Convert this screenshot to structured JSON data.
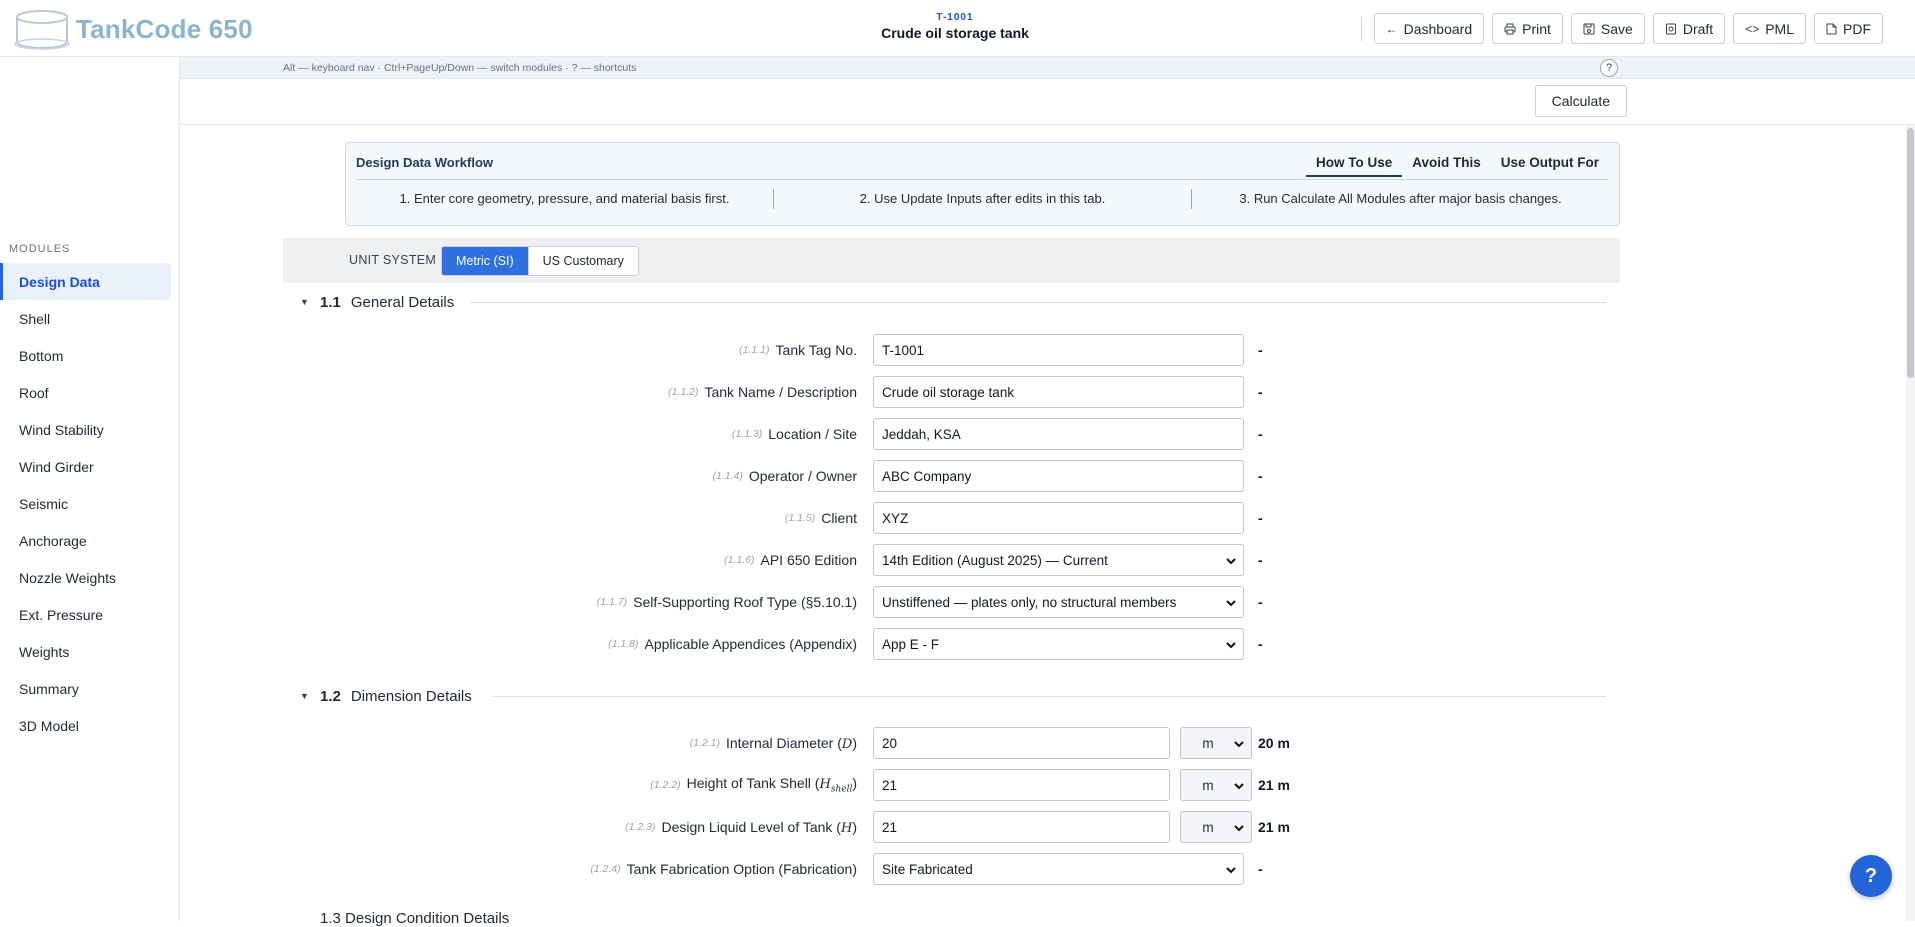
{
  "app": {
    "name": "TankCode 650"
  },
  "header": {
    "tag_id": "T-1001",
    "tag_name": "Crude oil storage tank",
    "buttons": [
      {
        "label": "Dashboard",
        "icon": "arrow-left-icon",
        "glyph": "←"
      },
      {
        "label": "Print",
        "icon": "printer-icon",
        "glyph": "⎙"
      },
      {
        "label": "Save",
        "icon": "save-icon",
        "glyph": "🖫"
      },
      {
        "label": "Draft",
        "icon": "draft-icon",
        "glyph": "⎘"
      },
      {
        "label": "PML",
        "icon": "code-icon",
        "glyph": "<>"
      },
      {
        "label": "PDF",
        "icon": "pdf-icon",
        "glyph": "▯"
      }
    ]
  },
  "hint": {
    "text": "Alt — keyboard nav · Ctrl+PageUp/Down — switch modules · ? — shortcuts",
    "help": "?"
  },
  "calculate_label": "Calculate",
  "sidebar": {
    "heading": "MODULES",
    "items": [
      {
        "label": "Design Data",
        "active": true
      },
      {
        "label": "Shell"
      },
      {
        "label": "Bottom"
      },
      {
        "label": "Roof"
      },
      {
        "label": "Wind Stability"
      },
      {
        "label": "Wind Girder"
      },
      {
        "label": "Seismic"
      },
      {
        "label": "Anchorage"
      },
      {
        "label": "Nozzle Weights"
      },
      {
        "label": "Ext. Pressure"
      },
      {
        "label": "Weights"
      },
      {
        "label": "Summary"
      },
      {
        "label": "3D Model"
      }
    ]
  },
  "workflow": {
    "title": "Design Data Workflow",
    "tabs": [
      "How To Use",
      "Avoid This",
      "Use Output For"
    ],
    "active_tab": "How To Use",
    "steps": [
      "1. Enter core geometry, pressure, and material basis first.",
      "2. Use Update Inputs after edits in this tab.",
      "3. Run Calculate All Modules after major basis changes."
    ]
  },
  "unit_system": {
    "label": "UNIT SYSTEM",
    "options": [
      "Metric (SI)",
      "US Customary"
    ],
    "selected": "Metric (SI)"
  },
  "sections": {
    "general": {
      "num": "1.1",
      "title": "General Details",
      "rows": [
        {
          "ref": "(1.1.1)",
          "label": "Tank Tag No.",
          "value": "T-1001",
          "result": "-",
          "type": "text"
        },
        {
          "ref": "(1.1.2)",
          "label": "Tank Name / Description",
          "value": "Crude oil storage tank",
          "result": "-",
          "type": "text"
        },
        {
          "ref": "(1.1.3)",
          "label": "Location / Site",
          "value": "Jeddah, KSA",
          "result": "-",
          "type": "text"
        },
        {
          "ref": "(1.1.4)",
          "label": "Operator / Owner",
          "value": "ABC Company",
          "result": "-",
          "type": "text"
        },
        {
          "ref": "(1.1.5)",
          "label": "Client",
          "value": "XYZ",
          "result": "-",
          "type": "text"
        },
        {
          "ref": "(1.1.6)",
          "label": "API 650 Edition",
          "value": "14th Edition (August 2025) — Current",
          "result": "-",
          "type": "select"
        },
        {
          "ref": "(1.1.7)",
          "label": "Self-Supporting Roof Type (§5.10.1)",
          "value": "Unstiffened — plates only, no structural members",
          "result": "-",
          "type": "select"
        },
        {
          "ref": "(1.1.8)",
          "label": "Applicable Appendices (Appendix)",
          "value": "App E - F",
          "result": "-",
          "type": "select"
        }
      ]
    },
    "dimension": {
      "num": "1.2",
      "title": "Dimension Details",
      "rows": [
        {
          "ref": "(1.2.1)",
          "label": "Internal Diameter (",
          "sym": "D",
          "sub": "",
          "value": "20",
          "unit": "m",
          "result": "20 m"
        },
        {
          "ref": "(1.2.2)",
          "label": "Height of Tank Shell (",
          "sym": "H",
          "sub": "shell",
          "value": "21",
          "unit": "m",
          "result": "21 m"
        },
        {
          "ref": "(1.2.3)",
          "label": "Design Liquid Level of Tank (",
          "sym": "H",
          "sub": "",
          "value": "21",
          "unit": "m",
          "result": "21 m"
        },
        {
          "ref": "(1.2.4)",
          "label": "Tank Fabrication Option (Fabrication)",
          "value": "Site Fabricated",
          "result": "-"
        }
      ]
    },
    "next": {
      "title": "1.3  Design Condition Details"
    }
  },
  "fab_label": "?",
  "colors": {
    "accent": "#2563eb",
    "logo": "#8bb4d3"
  }
}
